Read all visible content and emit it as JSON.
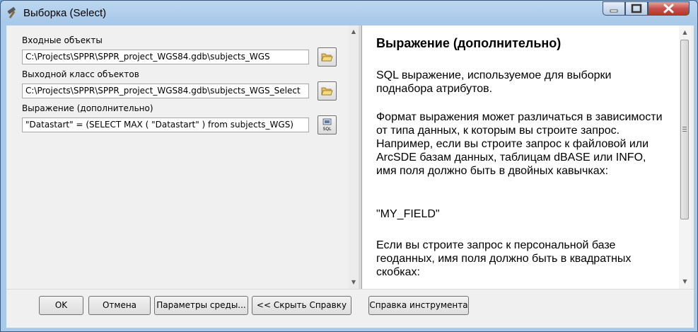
{
  "window": {
    "title": "Выборка (Select)"
  },
  "form": {
    "input_label": "Входные объекты",
    "input_value": "C:\\Projects\\SPPR\\SPPR_project_WGS84.gdb\\subjects_WGS",
    "output_label": "Выходной класс объектов",
    "output_value": "C:\\Projects\\SPPR\\SPPR_project_WGS84.gdb\\subjects_WGS_Select",
    "expr_label": "Выражение (дополнительно)",
    "expr_value": "\"Datastart\" = (SELECT MAX ( \"Datastart\" ) from subjects_WGS)"
  },
  "help": {
    "title": "Выражение (дополнительно)",
    "p1": "SQL выражение, используемое для выборки поднабора атрибутов.",
    "p2": "Формат выражения может различаться в зависимости от типа данных, к которым вы строите запрос. Например, если вы строите запрос к файловой или ArcSDE базам данных, таблицам dBASE или INFO, имя поля должно быть в двойных кавычках:",
    "p3": "\"MY_FIELD\"",
    "p4": "Если вы строите запрос к персональной базе геоданных, имя поля должно быть в квадратных скобках:"
  },
  "buttons": {
    "ok": "OK",
    "cancel": "Отмена",
    "env": "Параметры среды...",
    "hide_help": "<< Скрыть Справку",
    "tool_help": "Справка инструмента"
  },
  "icons": {
    "title": "hammer-icon",
    "browse": "folder-open-icon",
    "sql": "sql-icon"
  }
}
